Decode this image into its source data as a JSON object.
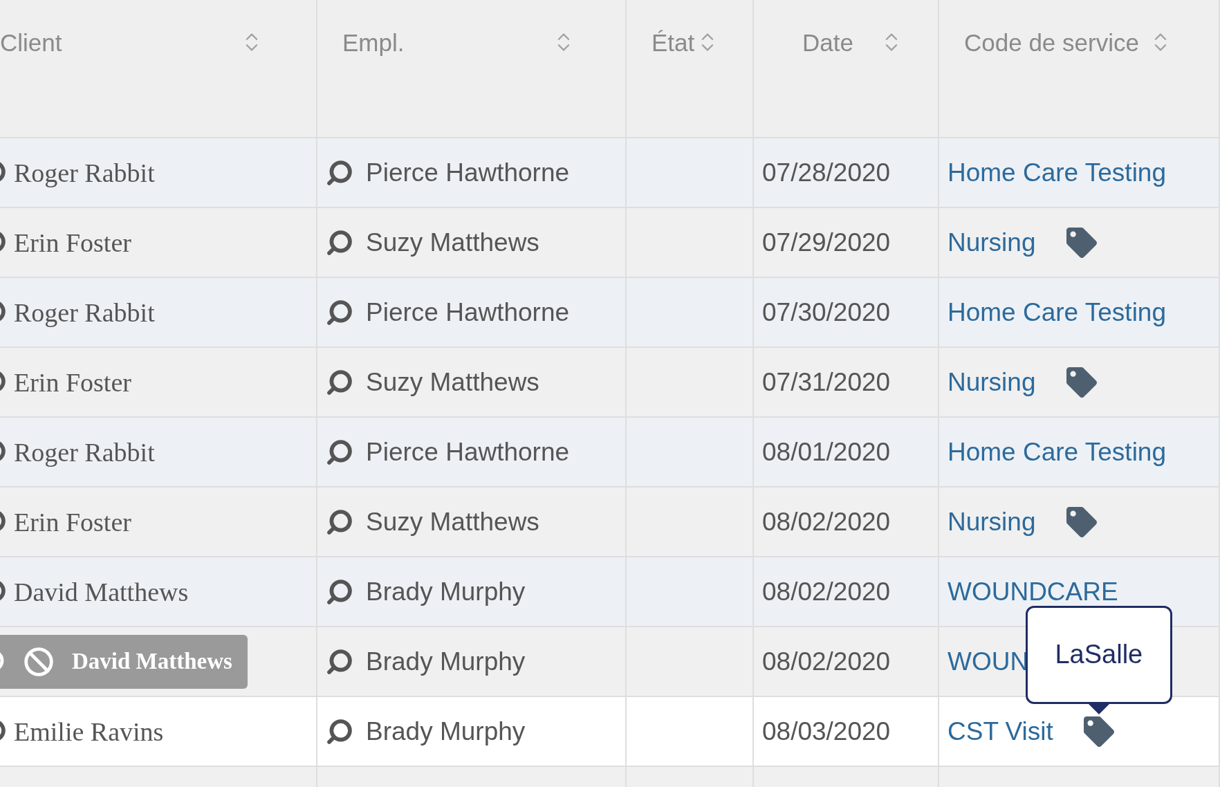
{
  "table": {
    "columns": [
      {
        "label": "Client"
      },
      {
        "label": "Empl."
      },
      {
        "label": "État"
      },
      {
        "label": "Date"
      },
      {
        "label": "Code de service"
      }
    ],
    "rows": [
      {
        "client": {
          "name": "Roger Rabbit",
          "kind": "plain"
        },
        "employee": "Pierce Hawthorne",
        "date": "07/28/2020",
        "service": {
          "text": "Home Care Testing",
          "tagged": false
        },
        "hovered": false
      },
      {
        "client": {
          "name": "Erin Foster",
          "kind": "plain"
        },
        "employee": "Suzy Matthews",
        "date": "07/29/2020",
        "service": {
          "text": "Nursing",
          "tagged": true
        },
        "hovered": false
      },
      {
        "client": {
          "name": "Roger Rabbit",
          "kind": "plain"
        },
        "employee": "Pierce Hawthorne",
        "date": "07/30/2020",
        "service": {
          "text": "Home Care Testing",
          "tagged": false
        },
        "hovered": false
      },
      {
        "client": {
          "name": "Erin Foster",
          "kind": "plain"
        },
        "employee": "Suzy Matthews",
        "date": "07/31/2020",
        "service": {
          "text": "Nursing",
          "tagged": true
        },
        "hovered": false
      },
      {
        "client": {
          "name": "Roger Rabbit",
          "kind": "plain"
        },
        "employee": "Pierce Hawthorne",
        "date": "08/01/2020",
        "service": {
          "text": "Home Care Testing",
          "tagged": false
        },
        "hovered": false
      },
      {
        "client": {
          "name": "Erin Foster",
          "kind": "plain"
        },
        "employee": "Suzy Matthews",
        "date": "08/02/2020",
        "service": {
          "text": "Nursing",
          "tagged": true
        },
        "hovered": false
      },
      {
        "client": {
          "name": "David Matthews",
          "kind": "plain"
        },
        "employee": "Brady Murphy",
        "date": "08/02/2020",
        "service": {
          "text": "WOUNDCARE",
          "tagged": false
        },
        "hovered": false
      },
      {
        "client": {
          "name": "David Matthews",
          "kind": "blocked"
        },
        "employee": "Brady Murphy",
        "date": "08/02/2020",
        "service": {
          "text": "WOUN",
          "tagged": false
        },
        "hovered": false
      },
      {
        "client": {
          "name": "Emilie Ravins",
          "kind": "plain"
        },
        "employee": "Brady Murphy",
        "date": "08/03/2020",
        "service": {
          "text": "CST Visit",
          "tagged": true,
          "tooltip": "LaSalle"
        },
        "hovered": true
      }
    ]
  }
}
